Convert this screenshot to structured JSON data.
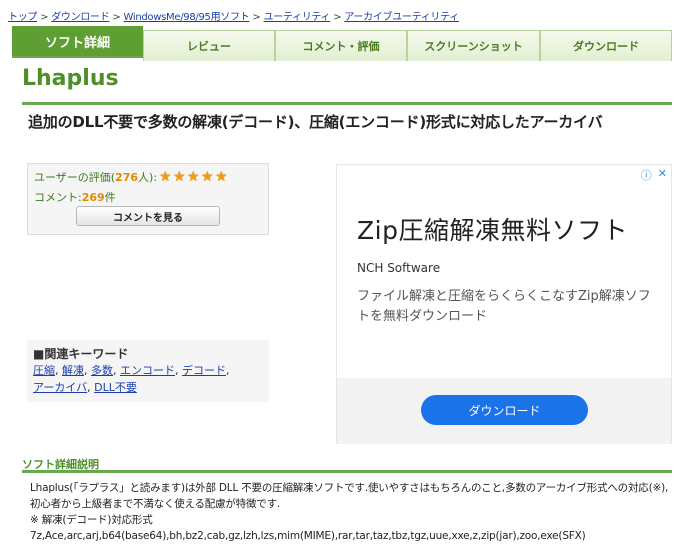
{
  "breadcrumb": [
    "トップ",
    "ダウンロード",
    "WindowsMe/98/95用ソフト",
    "ユーティリティ",
    "アーカイブユーティリティ"
  ],
  "breadcrumb_separator": ">",
  "tabs": [
    "ソフト詳細",
    "レビュー",
    "コメント・評価",
    "スクリーンショット",
    "ダウンロード"
  ],
  "app": {
    "title": "Lhaplus",
    "subtitle": "追加のDLL不要で多数の解凍(デコード)、圧縮(エンコード)形式に対応したアーカイバ"
  },
  "rating": {
    "label_prefix": "ユーザーの評価(",
    "count": "276",
    "label_suffix": "人):",
    "stars": 5,
    "comment_label": "コメント:",
    "comment_count": "269",
    "comment_unit": "件",
    "comment_button": "コメントを見る"
  },
  "keywords": {
    "title": "■関連キーワード",
    "items": [
      "圧縮",
      "解凍",
      "多数",
      "エンコード",
      "デコード",
      "アーカイバ",
      "DLL不要"
    ]
  },
  "ad": {
    "headline": "Zip圧縮解凍無料ソフト",
    "advertiser": "NCH Software",
    "description": "ファイル解凍と圧縮をらくらくこなすZip解凍ソフトを無料ダウンロード",
    "button": "ダウンロード",
    "icon_info": "ⓘ",
    "icon_close": "✕"
  },
  "description_section": {
    "title": "ソフト詳細説明",
    "lines": [
      "Lhaplus(「ラプラス」と読みます)は外部 DLL 不要の圧縮解凍ソフトです.使いやすさはもちろんのこと,多数のアーカイブ形式への対応(※),初心者から上級者まで不満なく使える配慮が特徴です.",
      "※ 解凍(デコード)対応形式",
      "7z,Ace,arc,arj,b64(base64),bh,bz2,cab,gz,lzh,lzs,mim(MIME),rar,tar,taz,tbz,tgz,uue,xxe,z,zip(jar),zoo,exe(SFX)"
    ]
  },
  "colors": {
    "accent_green": "#6aa84f",
    "title_green": "#4f8f2a",
    "link_blue": "#1a3ea8",
    "ad_button_blue": "#1a73e8",
    "star_orange": "#f39c12"
  }
}
